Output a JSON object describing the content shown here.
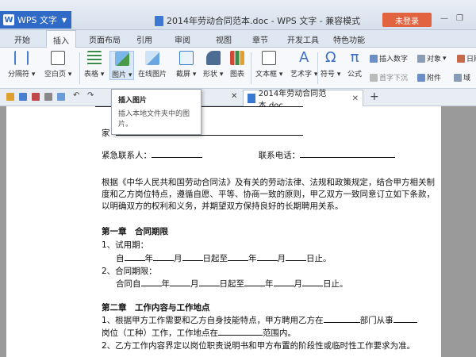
{
  "app": {
    "name": "WPS 文字",
    "logo_letter": "W"
  },
  "window": {
    "title": "2014年劳动合同范本.doc - WPS 文字 - 兼容模式",
    "login_label": "未登录"
  },
  "tabs": [
    "开始",
    "插入",
    "页面布局",
    "引用",
    "审阅",
    "视图",
    "章节",
    "开发工具",
    "特色功能"
  ],
  "active_tab": "插入",
  "ribbon": {
    "page_break": "分隔符",
    "blank_page": "空白页",
    "table": "表格",
    "picture": "图片",
    "online_picture": "在线图片",
    "screenshot": "截屏",
    "shape": "形状",
    "chart": "图表",
    "textbox": "文本框",
    "art_text": "艺术字",
    "symbol": "符号",
    "formula": "公式",
    "insert_number": "插入数字",
    "object": "对象",
    "date": "日期",
    "drop_cap": "首字下沉",
    "attachment": "附件",
    "field": "域"
  },
  "tooltip": {
    "title": "插入图片",
    "description": "插入本地文件夹中的图片。"
  },
  "document_tab": {
    "title": "2014年劳动合同范本.doc"
  },
  "document": {
    "line_partial1": "家",
    "emergency_contact": "紧急联系人：",
    "contact_phone": "联系电话：",
    "intro": [
      "根据《中华人民共和国劳动合同法》及有关的劳动法律、法规和政策规定，结合甲方相关制",
      "度和乙方岗位特点，遵循自愿、平等、协商一致的原则，甲乙双方一致同意订立如下条款，",
      "以明确双方的权利和义务，并期望双方保持良好的长期聘用关系。"
    ],
    "chapter1": "第一章　合同期限",
    "trial_label": "1、试用期：",
    "trial_line": {
      "from": "自",
      "year": "年",
      "month": "月",
      "day_from": "日起至",
      "day_to": "日止。"
    },
    "contract_label": "2、合同期限：",
    "contract_line": {
      "from": "合同自",
      "year": "年",
      "month": "月",
      "day_from": "日起至",
      "day_to": "日止。"
    },
    "chapter2": "第二章　工作内容与工作地点",
    "c2_line1_a": "1、根据甲方工作需要和乙方自身技能特点，甲方聘用乙方在",
    "c2_line1_b": "部门从事",
    "c2_line2_a": "岗位（工种）工作，工作地点在",
    "c2_line2_b": "范围内。",
    "c2_line3": "2、乙方工作内容界定以岗位职责说明书和甲方布置的阶段性或临时性工作要求为准。"
  },
  "colors": {
    "accent": "#2f6bc6",
    "login": "#e2633f"
  }
}
